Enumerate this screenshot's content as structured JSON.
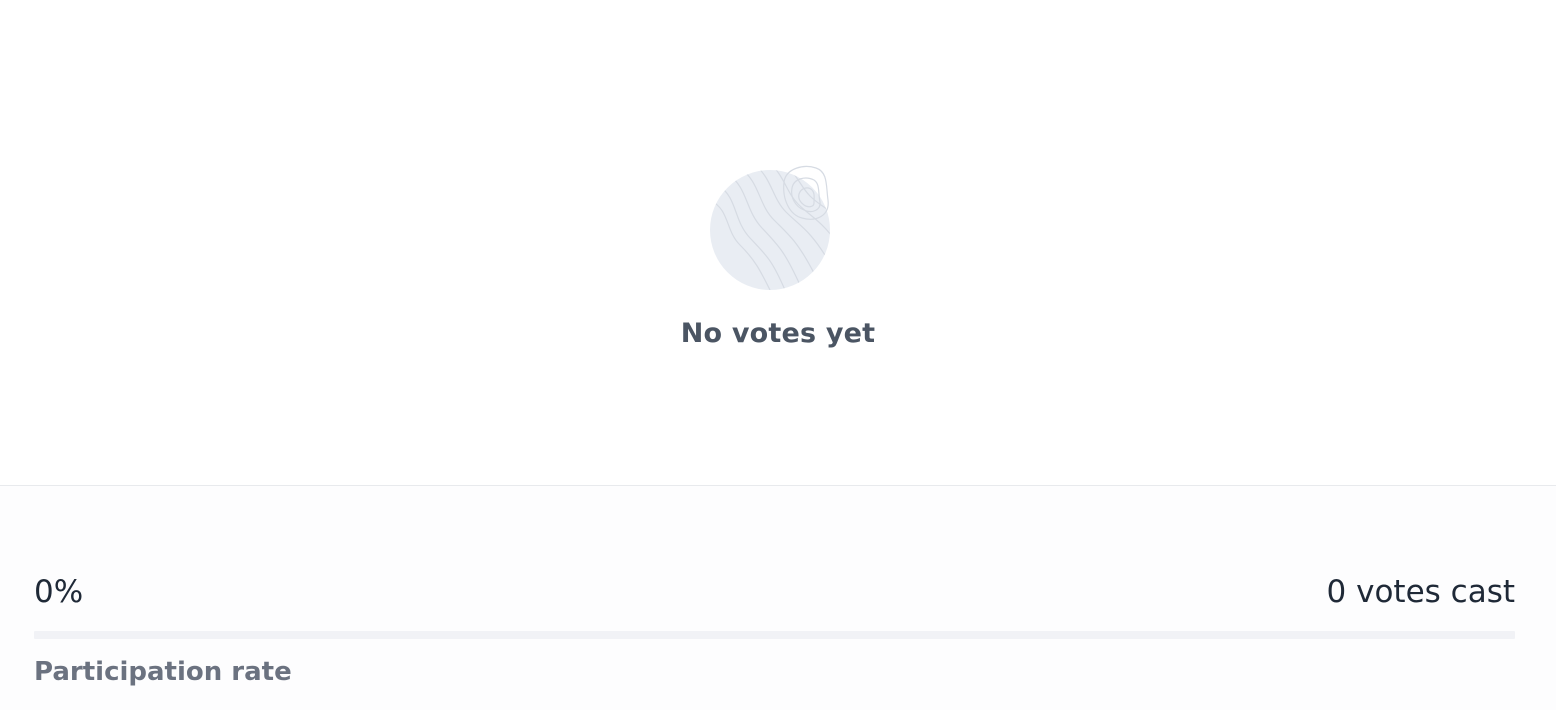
{
  "empty_state": {
    "title": "No votes yet",
    "icon": "topographic-globe-icon"
  },
  "participation": {
    "rate_text": "0%",
    "rate_fraction": 0,
    "votes_cast_text": "0 votes cast",
    "label": "Participation rate"
  },
  "colors": {
    "title_text": "#4b5563",
    "value_text": "#1f2937",
    "label_text": "#6b7280",
    "track": "#f1f2f6",
    "illustration_fill": "#e9edf3",
    "illustration_line": "#d6dbe3"
  }
}
